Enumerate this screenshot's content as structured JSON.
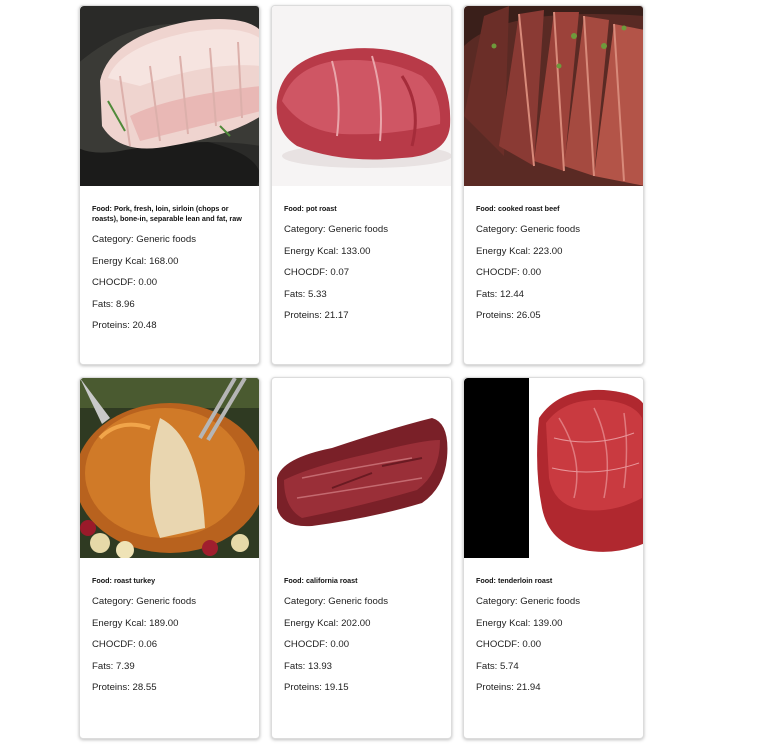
{
  "labels": {
    "food_prefix": "Food: ",
    "category_prefix": "Category: ",
    "energy_prefix": "Energy Kcal: ",
    "chocdf_prefix": "CHOCDF: ",
    "fats_prefix": "Fats: ",
    "proteins_prefix": "Proteins: "
  },
  "cards": [
    {
      "food": "Pork, fresh, loin, sirloin (chops or roasts), bone-in, separable lean and fat, raw",
      "category": "Generic foods",
      "energy": "168.00",
      "chocdf": "0.00",
      "fats": "8.96",
      "proteins": "20.48",
      "image": "raw-pork-loin-photo"
    },
    {
      "food": "pot roast",
      "category": "Generic foods",
      "energy": "133.00",
      "chocdf": "0.07",
      "fats": "5.33",
      "proteins": "21.17",
      "image": "raw-beef-roast-photo"
    },
    {
      "food": "cooked roast beef",
      "category": "Generic foods",
      "energy": "223.00",
      "chocdf": "0.00",
      "fats": "12.44",
      "proteins": "26.05",
      "image": "sliced-roast-beef-photo"
    },
    {
      "food": "roast turkey",
      "category": "Generic foods",
      "energy": "189.00",
      "chocdf": "0.06",
      "fats": "7.39",
      "proteins": "28.55",
      "image": "roast-turkey-photo"
    },
    {
      "food": "california roast",
      "category": "Generic foods",
      "energy": "202.00",
      "chocdf": "0.00",
      "fats": "13.93",
      "proteins": "19.15",
      "image": "raw-beef-cut-photo"
    },
    {
      "food": "tenderloin roast",
      "category": "Generic foods",
      "energy": "139.00",
      "chocdf": "0.00",
      "fats": "5.74",
      "proteins": "21.94",
      "image": "raw-tenderloin-photo"
    }
  ]
}
